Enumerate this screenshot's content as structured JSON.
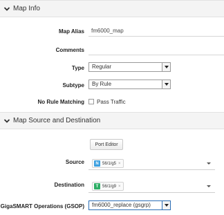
{
  "map_info": {
    "header": "Map Info",
    "fields": {
      "alias_label": "Map Alias",
      "alias_value": "fm6000_map",
      "comments_label": "Comments",
      "comments_value": "",
      "type_label": "Type",
      "type_value": "Regular",
      "subtype_label": "Subtype",
      "subtype_value": "By Rule",
      "no_rule_label": "No Rule Matching",
      "pass_traffic_label": "Pass Traffic",
      "pass_traffic_checked": false
    }
  },
  "source_destination": {
    "header": "Map Source and Destination",
    "port_editor_label": "Port Editor",
    "source_label": "Source",
    "source_chip": {
      "badge": "N",
      "text": "56/1/g5",
      "badge_color": "#3da0e0"
    },
    "destination_label": "Destination",
    "destination_chip": {
      "badge": "T",
      "text": "56/1/g9",
      "badge_color": "#2fae66"
    },
    "gsop_label": "GigaSMART Operations (GSOP)",
    "gsop_value": "fm6000_replace (gsgrp)"
  },
  "icons": {
    "section_toggle": "chevron-down-icon",
    "select_arrow": "caret-down-icon",
    "chip_remove": "remove-x-icon"
  },
  "colors": {
    "header_bg": "#f4f4f4",
    "focus_border": "#2a6db5"
  }
}
